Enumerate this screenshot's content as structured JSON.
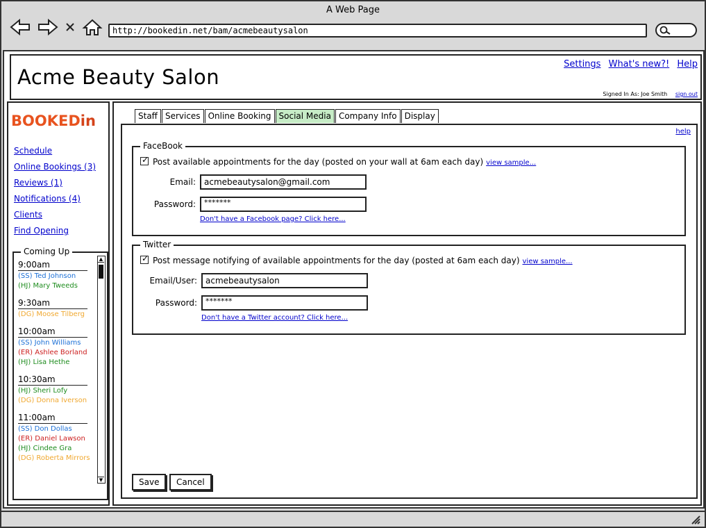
{
  "window": {
    "title": "A Web Page",
    "url": "http://bookedin.net/bam/acmebeautysalon"
  },
  "header": {
    "title": "Acme Beauty Salon",
    "links": [
      "Settings",
      "What's new?!",
      "Help"
    ],
    "signed_in": "Signed In As: Joe Smith",
    "sign_out": "sign out"
  },
  "logo": {
    "part1": "BOOKED",
    "part2": "in"
  },
  "nav": [
    "Schedule",
    "Online Bookings (3)",
    "Reviews (1)",
    "Notifications (4)",
    "Clients",
    "Find Opening"
  ],
  "coming_up": {
    "label": "Coming Up",
    "slots": [
      {
        "time": "9:00am",
        "appts": [
          {
            "text": "(SS) Ted Johnson",
            "color": "#1a6fd6"
          },
          {
            "text": "(HJ) Mary Tweeds",
            "color": "#1e8c1e"
          }
        ]
      },
      {
        "time": "9:30am",
        "appts": [
          {
            "text": "(DG) Moose Tilberg",
            "color": "#f0a830"
          }
        ]
      },
      {
        "time": "10:00am",
        "appts": [
          {
            "text": "(SS) John Williams",
            "color": "#1a6fd6"
          },
          {
            "text": "(ER) Ashlee Borland",
            "color": "#cc2020"
          },
          {
            "text": "(HJ) Lisa Hethe",
            "color": "#1e8c1e"
          }
        ]
      },
      {
        "time": "10:30am",
        "appts": [
          {
            "text": "(HJ) Sheri Lofy",
            "color": "#1e8c1e"
          },
          {
            "text": "(DG) Donna Iverson",
            "color": "#f0a830"
          }
        ]
      },
      {
        "time": "11:00am",
        "appts": [
          {
            "text": "(SS) Don Dollas",
            "color": "#1a6fd6"
          },
          {
            "text": "(ER) Daniel Lawson",
            "color": "#cc2020"
          },
          {
            "text": "(HJ) Cindee Gra",
            "color": "#1e8c1e"
          },
          {
            "text": "(DG) Roberta Mirrors",
            "color": "#f0a830"
          }
        ]
      }
    ]
  },
  "tabs": [
    {
      "label": "Staff",
      "active": false
    },
    {
      "label": "Services",
      "active": false
    },
    {
      "label": "Online Booking",
      "active": false
    },
    {
      "label": "Social Media",
      "active": true
    },
    {
      "label": "Company Info",
      "active": false
    },
    {
      "label": "Display",
      "active": false
    }
  ],
  "help_link": "help",
  "facebook": {
    "label": "FaceBook",
    "check_text": "Post available appointments for the day (posted on your wall at 6am each day)",
    "sample_link": "view sample...",
    "email_label": "Email:",
    "email_value": "acmebeautysalon@gmail.com",
    "password_label": "Password:",
    "password_value": "*******",
    "signup_link": "Don't have a Facebook page? Click here..."
  },
  "twitter": {
    "label": "Twitter",
    "check_text": "Post message notifying of available appointments for the day (posted at 6am each day)",
    "sample_link": "view sample...",
    "email_label": "Email/User:",
    "email_value": "acmebeautysalon",
    "password_label": "Password:",
    "password_value": "*******",
    "signup_link": "Don't have a Twitter account? Click here..."
  },
  "buttons": {
    "save": "Save",
    "cancel": "Cancel"
  }
}
